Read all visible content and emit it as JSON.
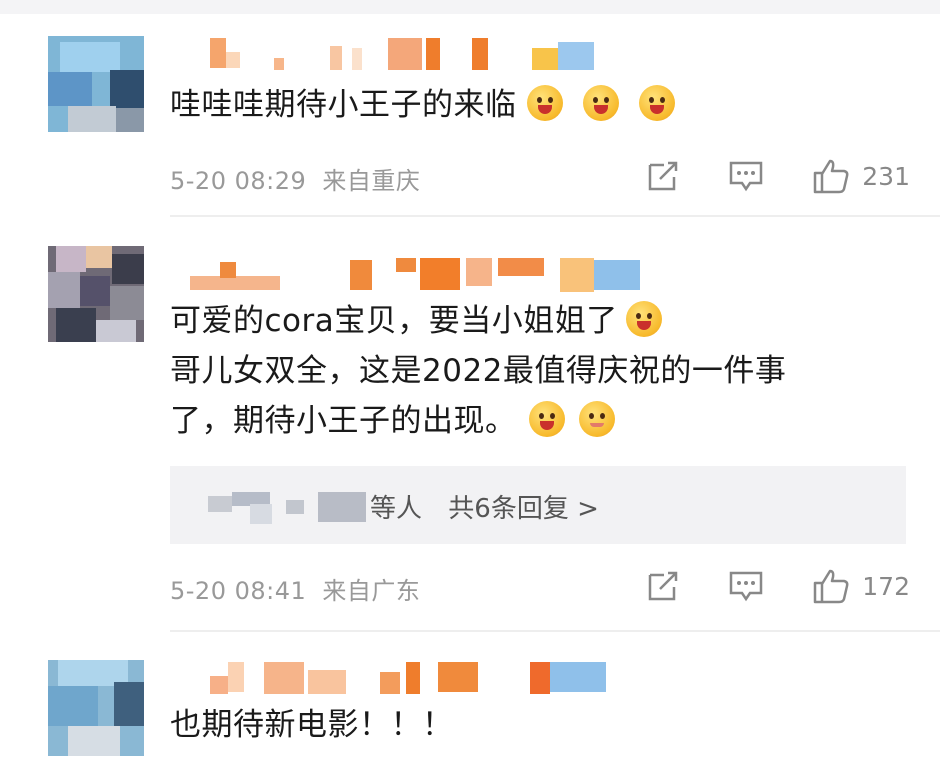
{
  "comments": [
    {
      "text": "哇哇哇期待小王子的来临",
      "emojis": [
        "cheer-emoji",
        "cheer-emoji",
        "cheer-emoji"
      ],
      "time": "5-20 08:29",
      "location": "来自重庆",
      "likes": "231"
    },
    {
      "text_lines": [
        "可爱的cora宝贝，要当小姐姐了",
        "哥儿女双全，这是2022最值得庆祝的一件事",
        "了，期待小王子的出现。"
      ],
      "replies_summary": {
        "prefix": "等人",
        "count_text": "共6条回复 >"
      },
      "time": "5-20 08:41",
      "location": "来自广东",
      "likes": "172"
    },
    {
      "text": "也期待新电影！！！"
    }
  ],
  "icons": {
    "share": "share-icon",
    "comment": "comment-icon",
    "like": "thumbs-up-icon"
  },
  "colors": {
    "username_blur": "#f0822a",
    "meta": "#999999",
    "reply_bg": "#f2f2f4"
  }
}
